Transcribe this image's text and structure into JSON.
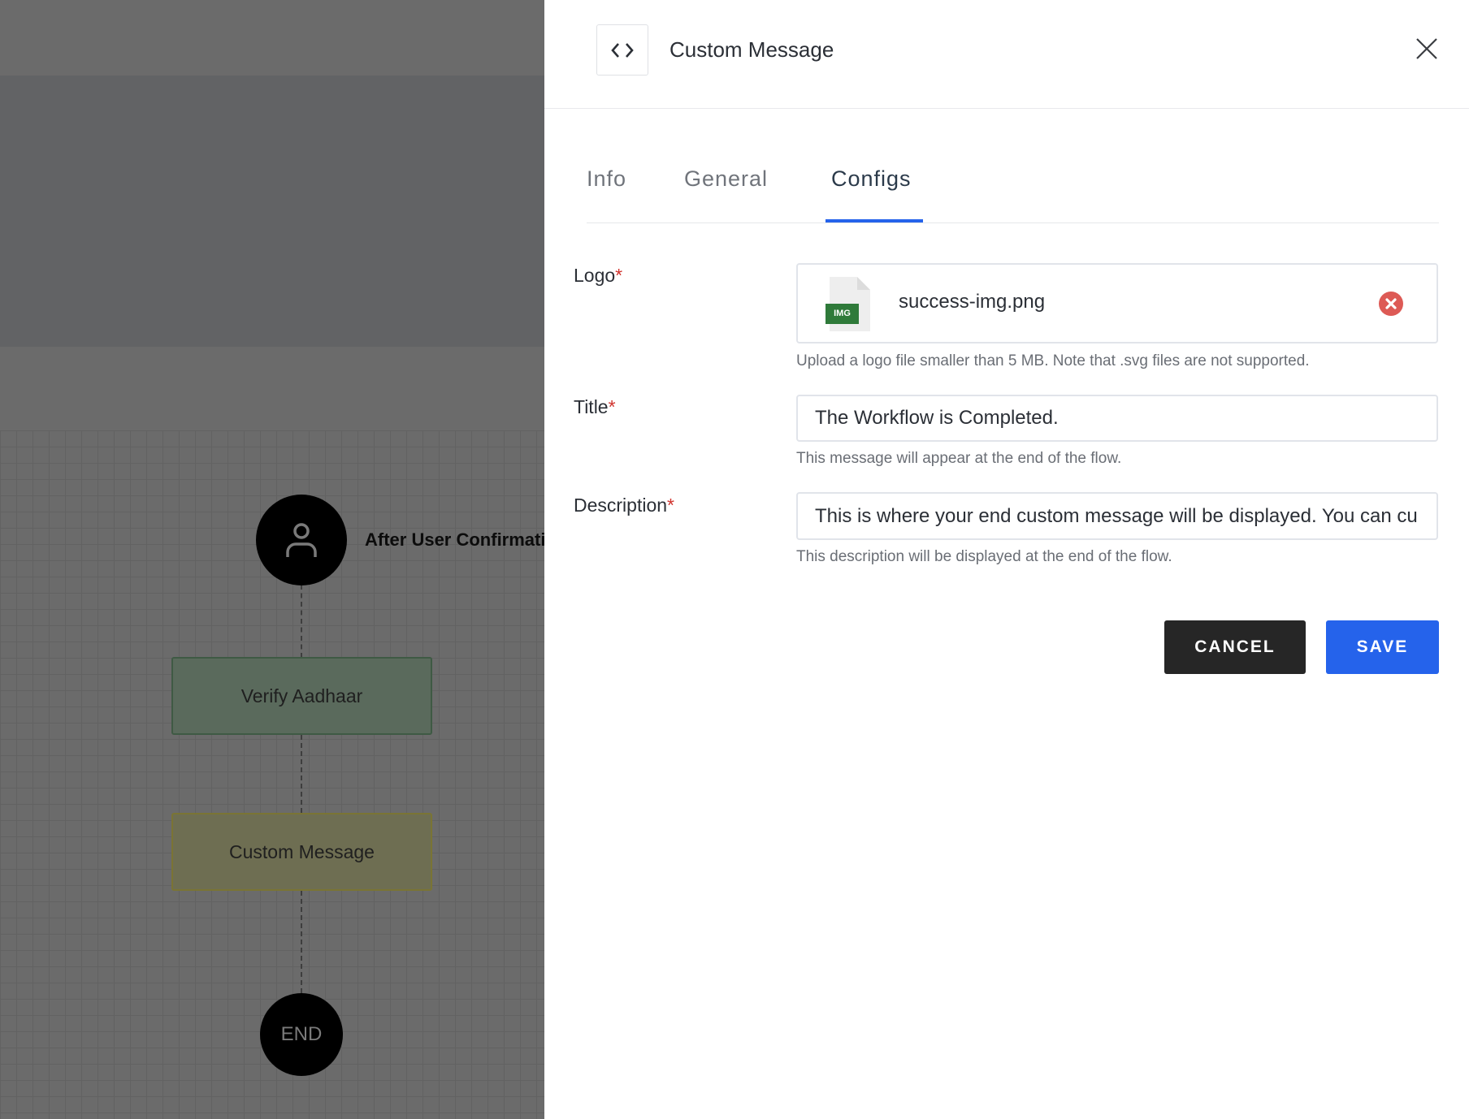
{
  "canvas": {
    "start_node_label": "After User Confirmation",
    "nodes": [
      {
        "label": "Verify Aadhaar",
        "color": "#5a6a5c"
      },
      {
        "label": "Custom Message",
        "color": "#6e6e52"
      }
    ],
    "end_label": "END"
  },
  "panel": {
    "title": "Custom Message",
    "header_icon": "code-icon",
    "tabs": [
      {
        "label": "Info"
      },
      {
        "label": "General"
      },
      {
        "label": "Configs",
        "active": true
      }
    ],
    "fields": {
      "logo": {
        "label": "Logo",
        "required": "*",
        "file_name": "success-img.png",
        "file_badge": "IMG",
        "hint": "Upload a logo file smaller than 5 MB. Note that .svg files are not supported."
      },
      "title": {
        "label": "Title",
        "required": "*",
        "value": "The Workflow is Completed.",
        "hint": "This message will appear at the end of the flow."
      },
      "description": {
        "label": "Description",
        "required": "*",
        "value": "This is where your end custom message will be displayed. You can cu",
        "hint": "This description will be displayed at the end of the flow."
      }
    },
    "cancel_label": "CANCEL",
    "save_label": "SAVE",
    "accent": "#2563eb"
  }
}
